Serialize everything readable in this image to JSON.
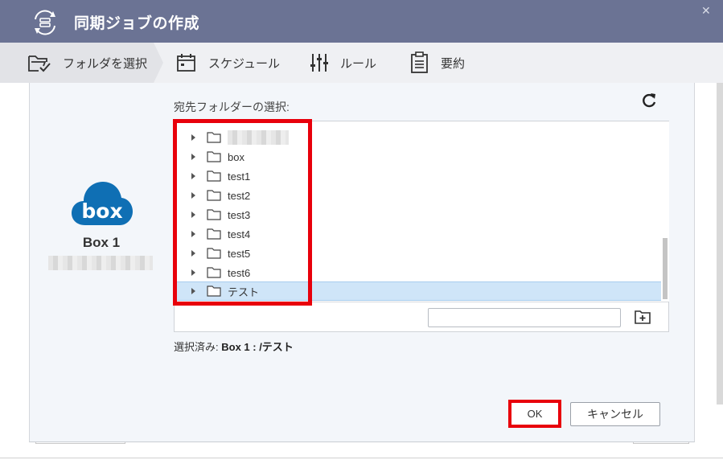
{
  "window": {
    "title": "同期ジョブの作成",
    "close_icon": "close-icon"
  },
  "steps": [
    {
      "label": "フォルダを選択",
      "icon": "folder-check-icon",
      "active": true
    },
    {
      "label": "スケジュール",
      "icon": "calendar-icon",
      "active": false
    },
    {
      "label": "ルール",
      "icon": "sliders-icon",
      "active": false
    },
    {
      "label": "要約",
      "icon": "clipboard-icon",
      "active": false
    }
  ],
  "account": {
    "name": "Box 1",
    "logo_text": "box",
    "logo_color": "#0f6fb4"
  },
  "dialog": {
    "dest_label": "宛先フォルダーの選択:",
    "folders": [
      "box",
      "test1",
      "test2",
      "test3",
      "test4",
      "test5",
      "test6",
      "テスト"
    ],
    "selected_folder": "テスト",
    "selected_prefix": "選択済み: ",
    "selected_value": "Box 1 : /テスト",
    "folder_name_input": "",
    "ok_label": "OK",
    "cancel_label": "キャンセル"
  },
  "colors": {
    "titlebar": "#6b7394",
    "highlight": "#e8000b",
    "selected_row": "#cfe5f8"
  }
}
